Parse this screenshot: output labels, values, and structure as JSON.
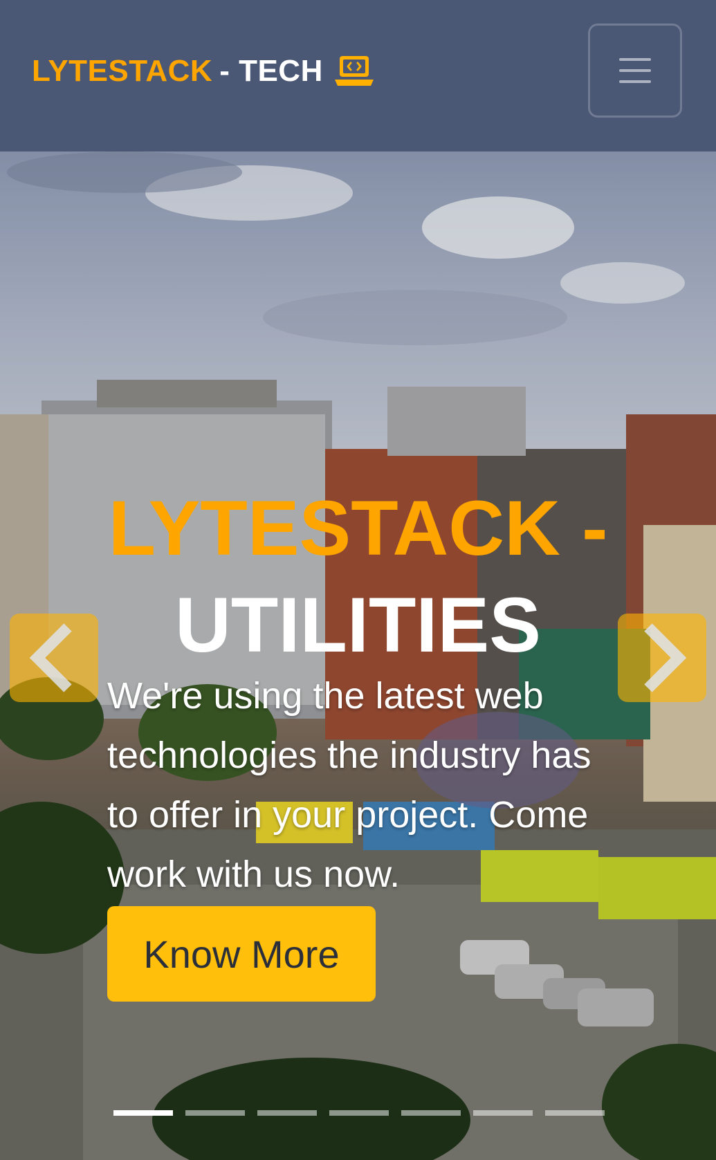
{
  "navbar": {
    "brand_primary": "LYTESTACK",
    "brand_secondary": "- TECH",
    "brand_icon": "laptop-code-icon",
    "toggler_icon": "hamburger-menu-icon"
  },
  "hero": {
    "title_primary": "LYTESTACK -",
    "title_secondary": "UTILITIES",
    "text": "We're using the latest web technologies the industry has to offer in your project. Come work with us now.",
    "cta_label": "Know More",
    "prev_icon": "chevron-left-icon",
    "next_icon": "chevron-right-icon",
    "slide_count": 7,
    "active_slide": 1
  },
  "colors": {
    "navbar_bg": "#4a5775",
    "brand_accent": "#ffa500",
    "cta_bg": "#ffbf0a"
  }
}
